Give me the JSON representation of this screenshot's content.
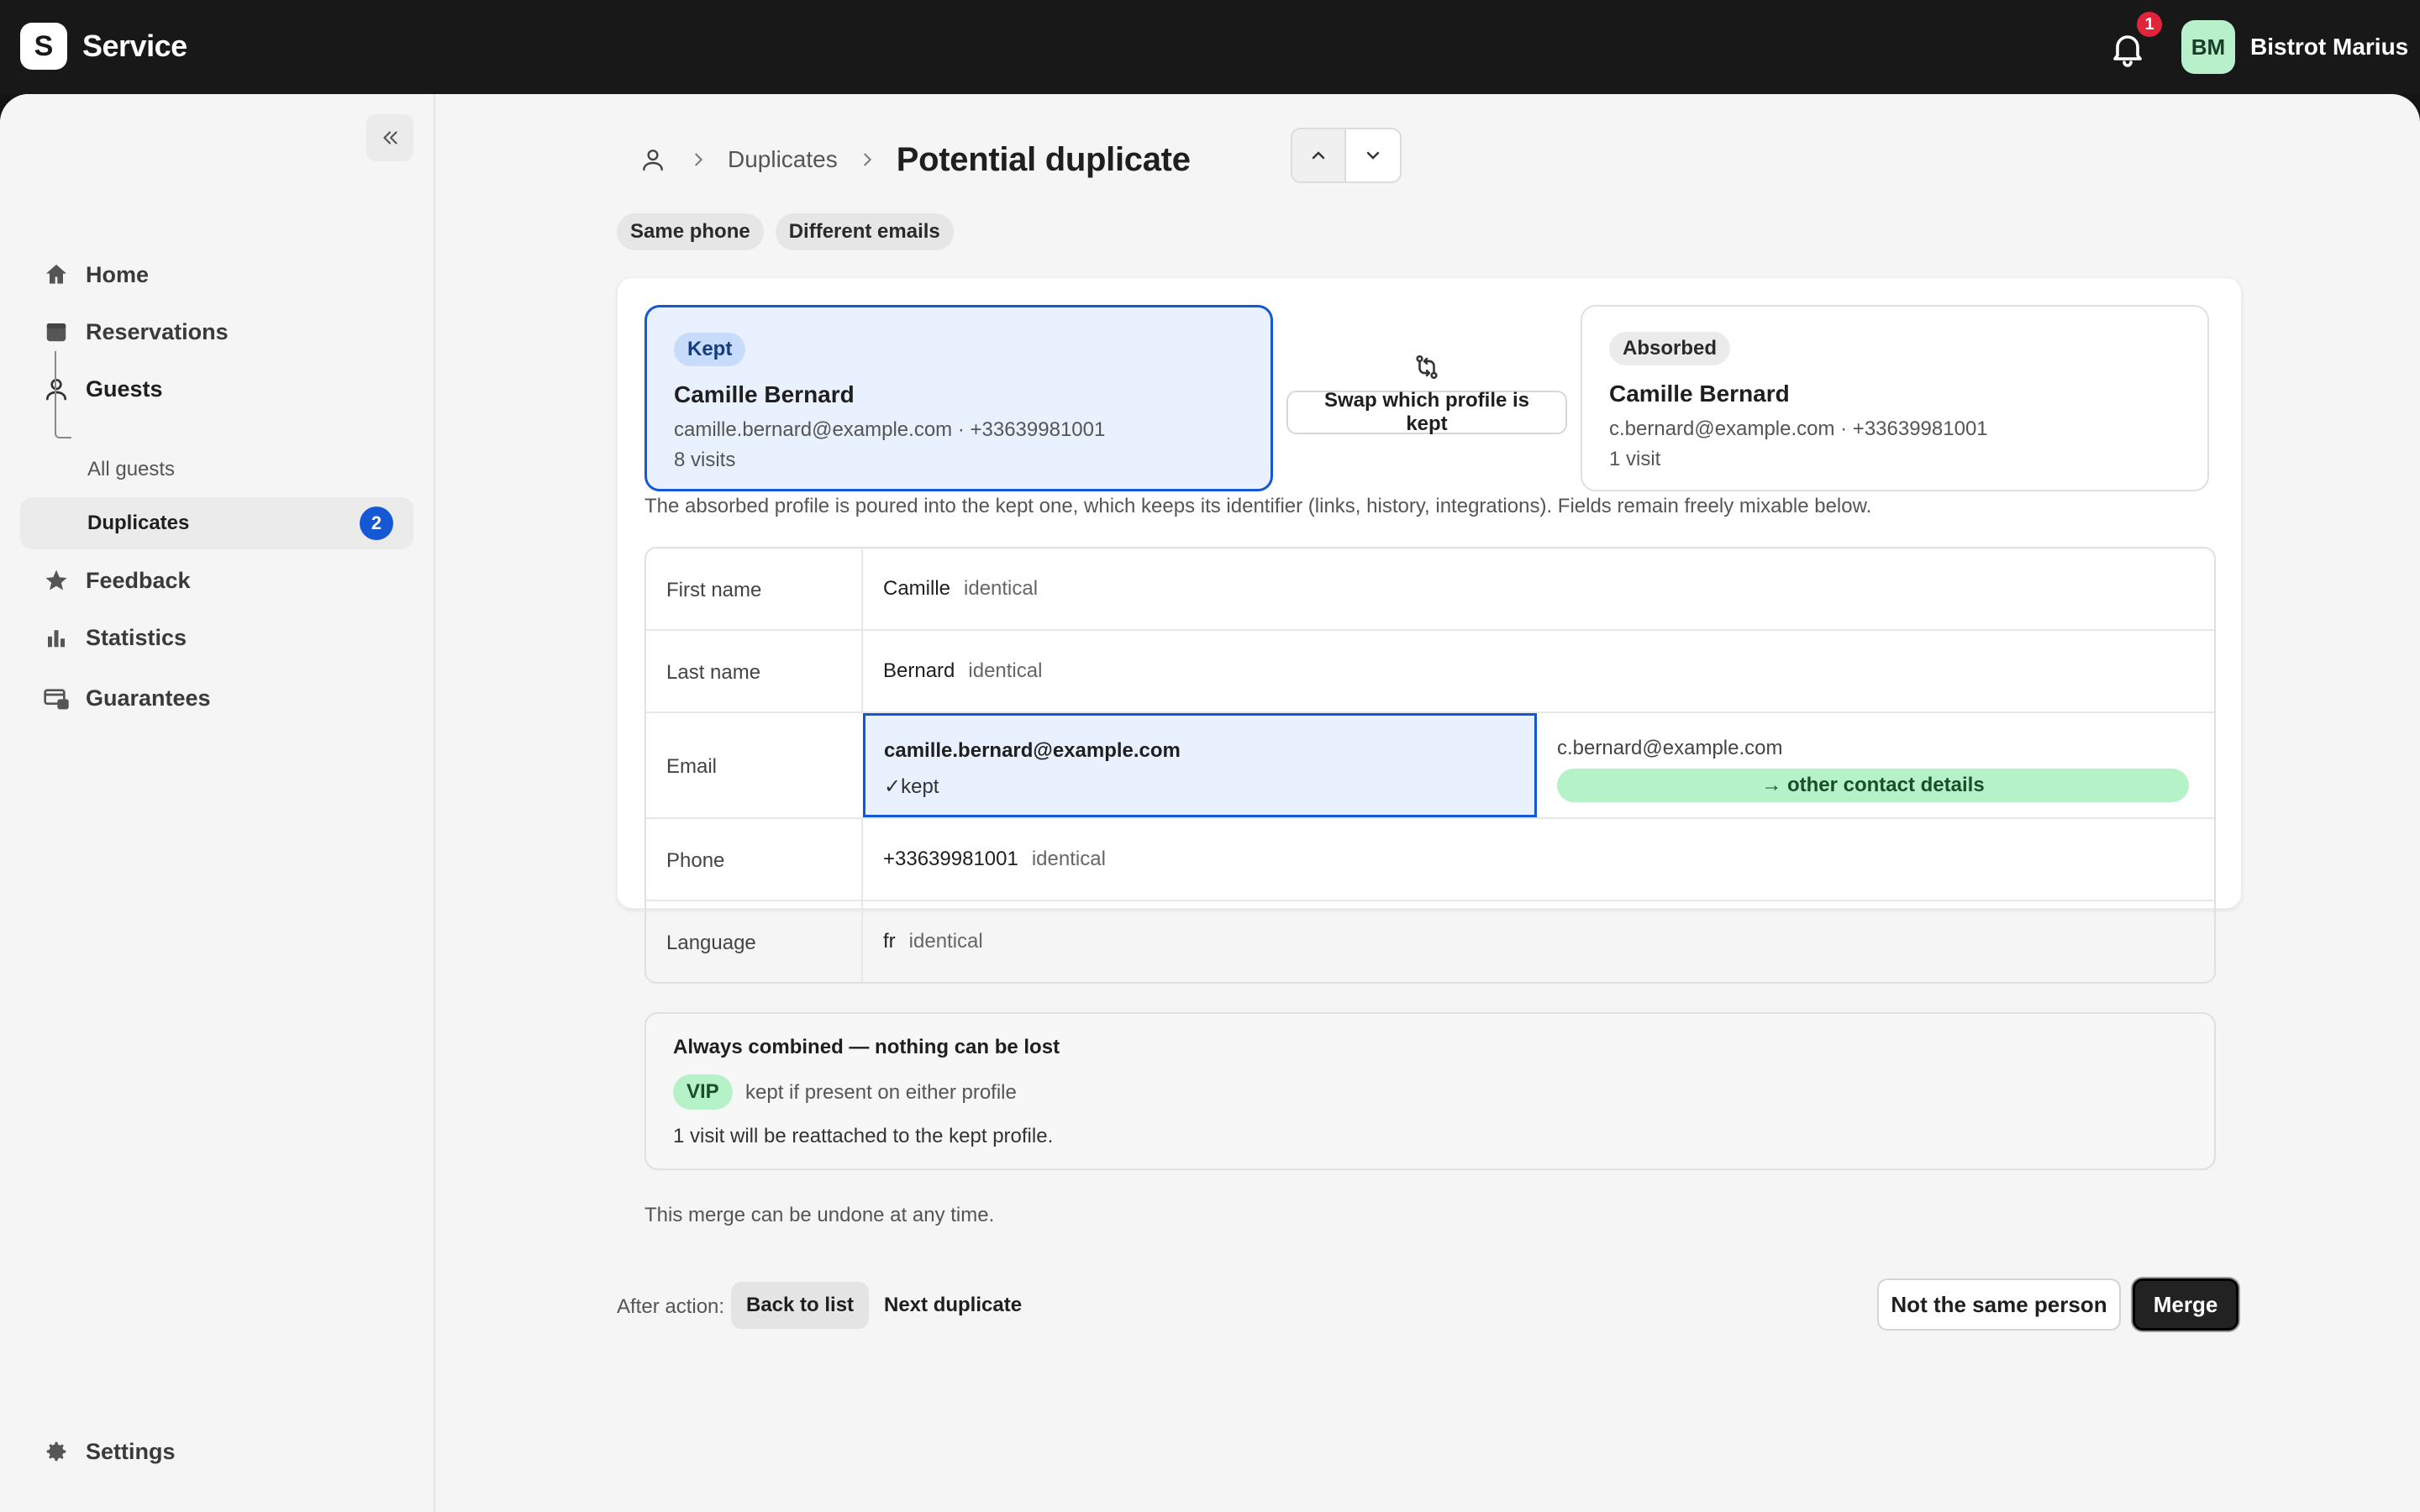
{
  "app": {
    "logo_letter": "S",
    "name": "Service"
  },
  "header": {
    "notification_count": "1",
    "user_initials": "BM",
    "user_name": "Bistrot Marius"
  },
  "sidebar": {
    "items": [
      {
        "label": "Home",
        "icon": "home-icon"
      },
      {
        "label": "Reservations",
        "icon": "calendar-icon"
      },
      {
        "label": "Guests",
        "icon": "person-icon"
      },
      {
        "label": "Feedback",
        "icon": "star-icon"
      },
      {
        "label": "Statistics",
        "icon": "bar-chart-icon"
      },
      {
        "label": "Guarantees",
        "icon": "card-lock-icon"
      }
    ],
    "guests_sub": [
      {
        "label": "All guests"
      },
      {
        "label": "Duplicates",
        "badge": "2"
      }
    ],
    "settings_label": "Settings"
  },
  "breadcrumb": {
    "parent": "Duplicates",
    "current": "Potential duplicate"
  },
  "tags": [
    "Same phone",
    "Different emails"
  ],
  "kept": {
    "role": "Kept",
    "name": "Camille Bernard",
    "contact": "camille.bernard@example.com · +33639981001",
    "visits": "8 visits"
  },
  "absorbed": {
    "role": "Absorbed",
    "name": "Camille Bernard",
    "contact": "c.bernard@example.com · +33639981001",
    "visits": "1 visit"
  },
  "swap_label": "Swap which profile is kept",
  "explanation": "The absorbed profile is poured into the kept one, which keeps its identifier (links, history, integrations). Fields remain freely mixable below.",
  "fields": {
    "identical_label": "identical",
    "first_name": {
      "label": "First name",
      "value": "Camille"
    },
    "last_name": {
      "label": "Last name",
      "value": "Bernard"
    },
    "email": {
      "label": "Email",
      "kept_value": "camille.bernard@example.com",
      "kept_marker": "✓kept",
      "other_value": "c.bernard@example.com",
      "other_marker": "→ other contact details"
    },
    "phone": {
      "label": "Phone",
      "value": "+33639981001"
    },
    "language": {
      "label": "Language",
      "value": "fr"
    }
  },
  "combined": {
    "title": "Always combined — nothing can be lost",
    "vip_label": "VIP",
    "vip_text": "kept if present on either profile",
    "reattach_text": "1 visit will be reattached to the kept profile."
  },
  "undo_text": "This merge can be undone at any time.",
  "footer": {
    "after_action_label": "After action:",
    "options": [
      "Back to list",
      "Next duplicate"
    ],
    "selected_option": "Back to list",
    "not_same_label": "Not the same person",
    "merge_label": "Merge"
  },
  "colors": {
    "accent": "#1558d6",
    "green_chip": "#b6f2c8",
    "topbar": "#181818",
    "alert": "#e0243a"
  }
}
